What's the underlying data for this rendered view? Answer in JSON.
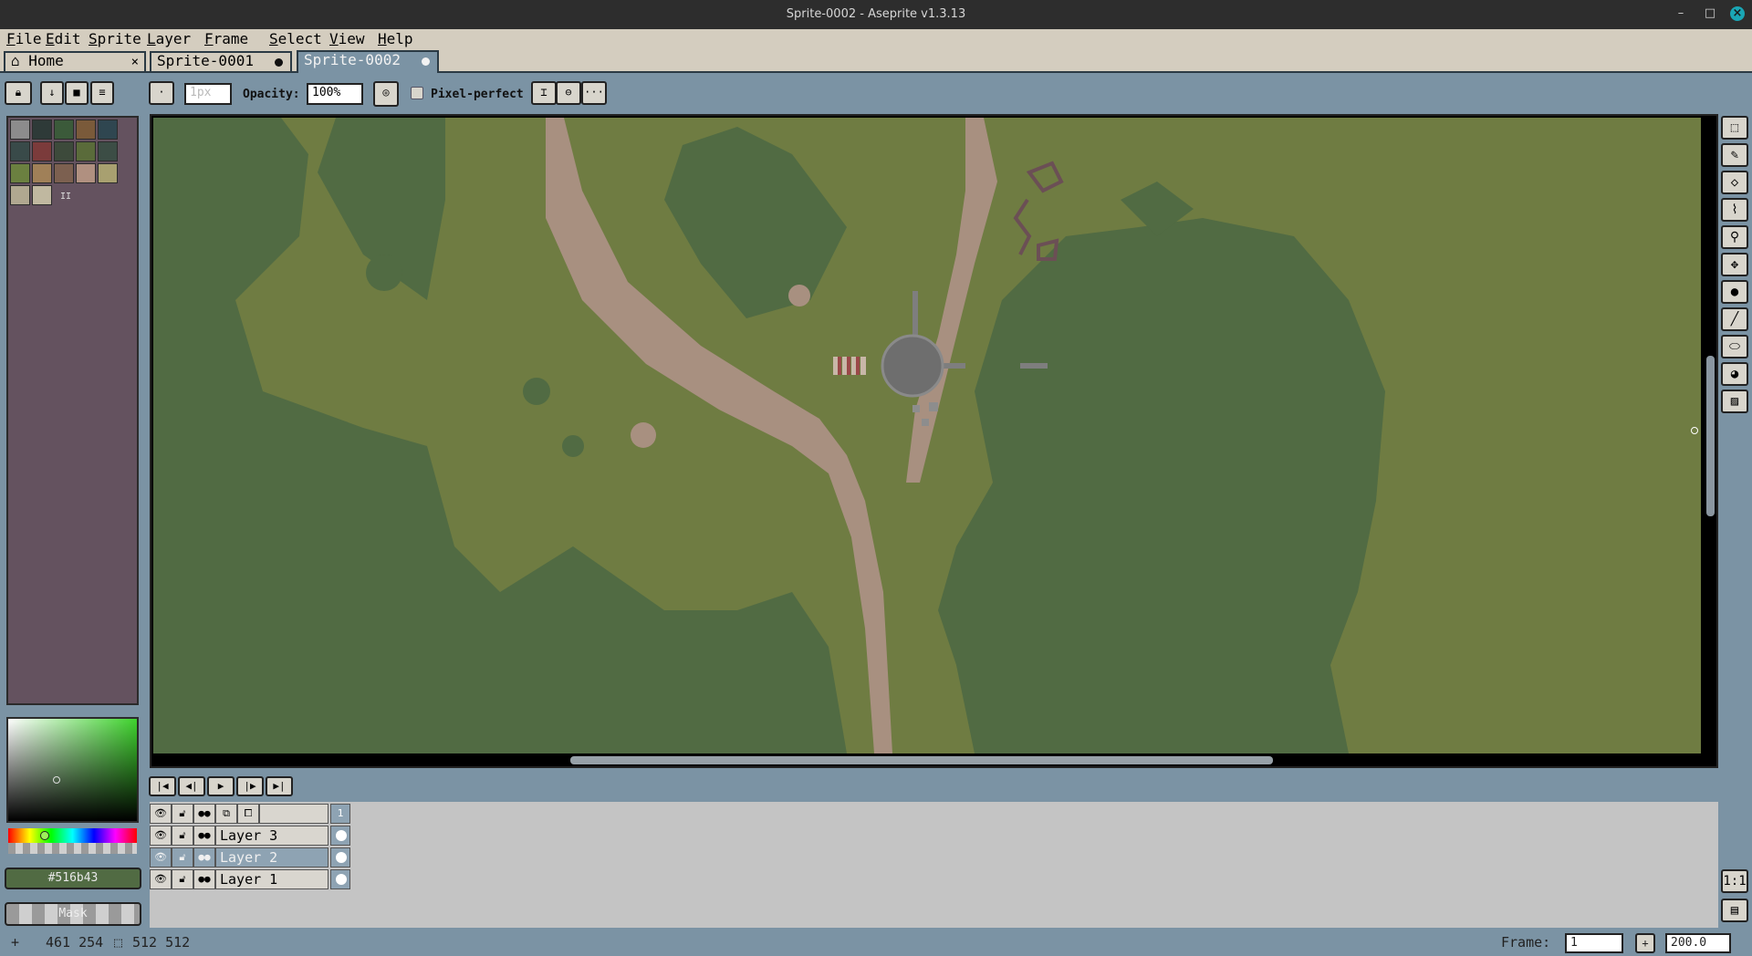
{
  "window": {
    "title": "Sprite-0002 - Aseprite v1.3.13"
  },
  "menu": [
    {
      "label": "File",
      "ul": "F",
      "rest": "ile"
    },
    {
      "label": "Edit",
      "ul": "E",
      "rest": "dit"
    },
    {
      "label": "Sprite",
      "ul": "S",
      "rest": "prite"
    },
    {
      "label": "Layer",
      "ul": "L",
      "rest": "ayer"
    },
    {
      "label": "Frame",
      "ul": "F",
      "rest": "rame"
    },
    {
      "label": "Select",
      "ul": "S",
      "rest": "elect"
    },
    {
      "label": "View",
      "ul": "V",
      "rest": "iew"
    },
    {
      "label": "Help",
      "ul": "H",
      "rest": "elp"
    }
  ],
  "tabs": [
    {
      "label": "Home",
      "icon": "home-icon",
      "close": "×"
    },
    {
      "label": "Sprite-0001",
      "modified": true
    },
    {
      "label": "Sprite-0002",
      "modified": true,
      "active": true
    }
  ],
  "context_bar": {
    "brush_size_placeholder": "1px",
    "opacity_label": "Opacity:",
    "opacity_value": "100%",
    "pixel_perfect_label": "Pixel-perfect",
    "more": "···"
  },
  "palette": [
    "#8c8c8c",
    "#2e3a38",
    "#3b5a3a",
    "#7a5a3a",
    "#2f4650",
    "#394a49",
    "#7b3b3b",
    "#3d4a3b",
    "#5a6b3a",
    "#3c4d45",
    "#6b8040",
    "#a08058",
    "#7c6050",
    "#b09080",
    "#a8a070",
    "#b0a890",
    "#c0b8a0"
  ],
  "color": {
    "foreground_hex": "#516b43",
    "canvas_bg": "#6f7c42",
    "dark_green": "#516b43",
    "path": "#a89080"
  },
  "mask_label": "Mask",
  "timeline": {
    "frame_header": "1",
    "layers": [
      {
        "name": "Layer 3",
        "active": false
      },
      {
        "name": "Layer 2",
        "active": true
      },
      {
        "name": "Layer 1",
        "active": false
      }
    ]
  },
  "status": {
    "cursor": "461 254",
    "size": "512 512",
    "frame_label": "Frame:",
    "frame_value": "1",
    "zoom": "200.0"
  }
}
